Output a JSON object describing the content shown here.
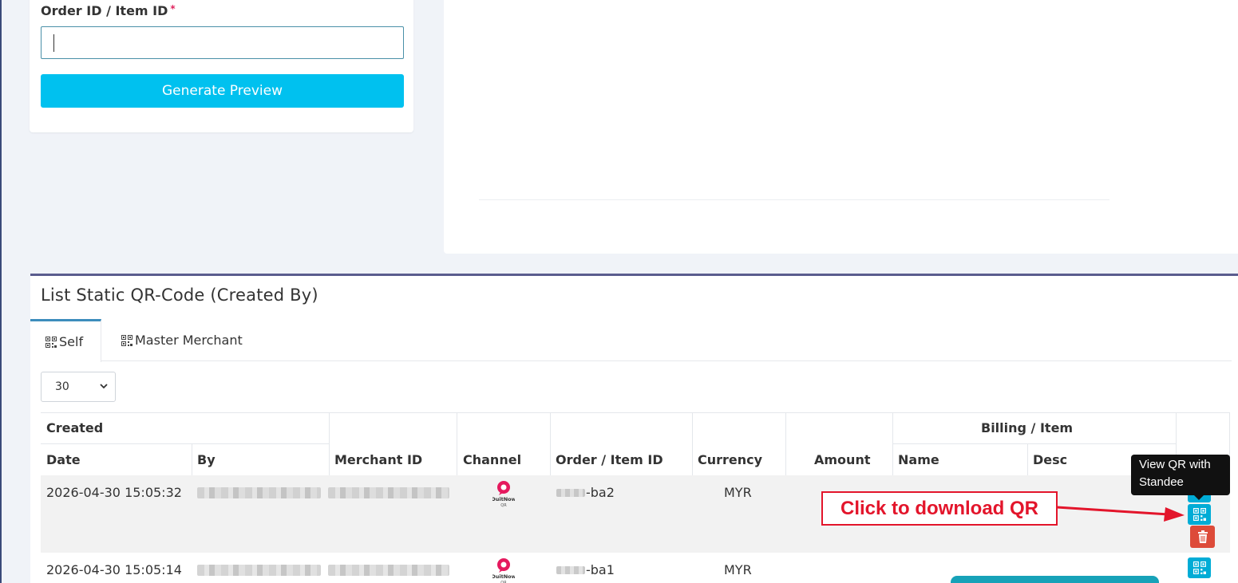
{
  "form": {
    "label": "Order ID / Item ID",
    "required_mark": "*",
    "input_value": "",
    "button_label": "Generate Preview"
  },
  "list": {
    "title": "List Static QR-Code (Created By)",
    "tabs": [
      {
        "label": "Self",
        "icon": "qrcode-icon",
        "active": true
      },
      {
        "label": "Master Merchant",
        "icon": "qrcode-icon",
        "active": false
      }
    ],
    "page_size": "30"
  },
  "table": {
    "headers": {
      "created": "Created",
      "date": "Date",
      "by": "By",
      "merchant_id": "Merchant ID",
      "channel": "Channel",
      "order_item_id": "Order / Item ID",
      "currency": "Currency",
      "amount": "Amount",
      "billing_item": "Billing / Item",
      "name": "Name",
      "desc": "Desc"
    },
    "rows": [
      {
        "date": "2026-04-30 15:05:32",
        "order_suffix": "-ba2",
        "currency": "MYR",
        "channel_icon": "duitnow-qr-icon"
      },
      {
        "date": "2026-04-30 15:05:14",
        "order_suffix": "-ba1",
        "currency": "MYR",
        "channel_icon": "duitnow-qr-icon"
      }
    ]
  },
  "channel_logo": {
    "line1": "DuitNow",
    "line2": "QR"
  },
  "tooltip": {
    "text": "View QR with Standee"
  },
  "annotation": {
    "text": "Click to download QR",
    "color": "#e3152b"
  },
  "colors": {
    "primary_button": "#00c1ef",
    "action_cyan": "#00acd6",
    "action_red": "#dd4b39",
    "card_accent": "#5a5c8e"
  }
}
